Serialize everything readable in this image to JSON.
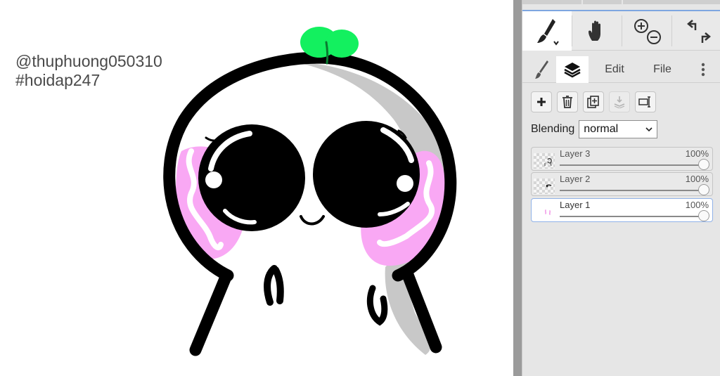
{
  "canvas": {
    "watermark_lines": [
      "@thuphuong050310",
      "#hoidap247"
    ],
    "background": "#ffffff",
    "art_colors": {
      "outline": "#000000",
      "blush": "#f9a8f4",
      "sprout": "#13f05f",
      "shadow": "#c8c8c8"
    }
  },
  "toolbar": {
    "tools": [
      {
        "name": "brush-tool",
        "icon": "brush-icon",
        "active": true
      },
      {
        "name": "hand-tool",
        "icon": "hand-icon",
        "active": false
      },
      {
        "name": "zoom-tool",
        "icon": "zoom-in-out-icon",
        "active": false
      },
      {
        "name": "undo-redo",
        "icon": "undo-redo-icon",
        "active": false
      }
    ]
  },
  "tabs": {
    "brush_icon": "brush-icon",
    "layers_icon": "layers-icon",
    "edit_label": "Edit",
    "file_label": "File",
    "more_icon": "more-vertical-icon",
    "active": "layers"
  },
  "layer_tools": [
    "add-layer-icon",
    "delete-layer-icon",
    "duplicate-layer-icon",
    "merge-down-icon",
    "rename-layer-icon"
  ],
  "blending": {
    "label": "Blending",
    "value": "normal"
  },
  "layers": [
    {
      "name": "Layer 3",
      "opacity": "100%",
      "opacity_value": 1.0,
      "selected": false
    },
    {
      "name": "Layer 2",
      "opacity": "100%",
      "opacity_value": 1.0,
      "selected": false
    },
    {
      "name": "Layer 1",
      "opacity": "100%",
      "opacity_value": 1.0,
      "selected": true
    }
  ],
  "colors": {
    "panel_bg": "#e6e6e6",
    "accent": "#7ea6e0",
    "divider": "#9b9b9b"
  }
}
